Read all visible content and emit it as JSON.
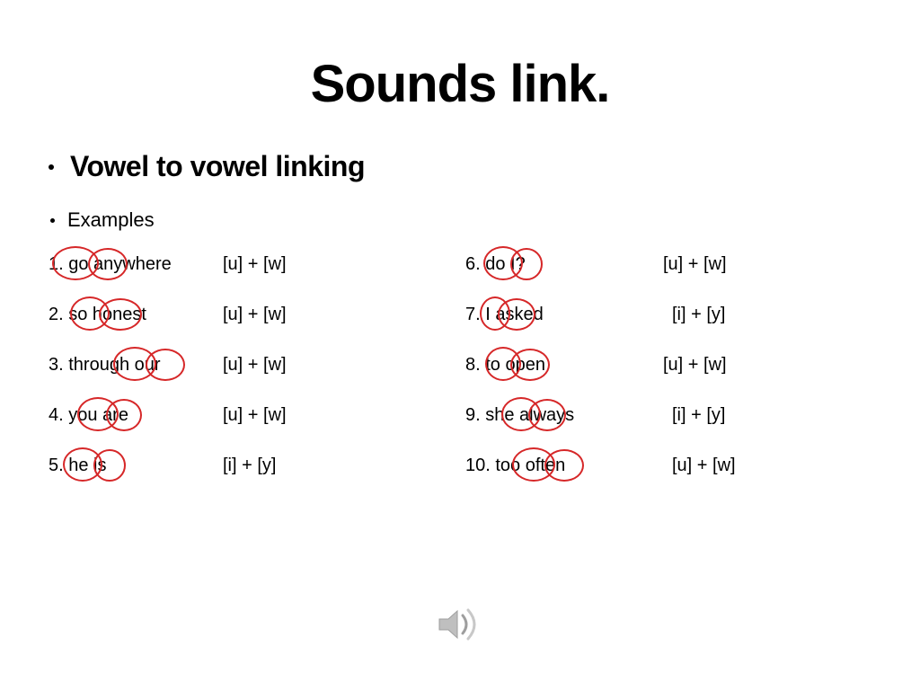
{
  "title": "Sounds link.",
  "subtitle": "Vowel to vowel linking",
  "examples_label": "Examples",
  "rows": {
    "r1": {
      "left_phrase": "1. go anywhere",
      "left_notation": "[u] + [w]",
      "right_phrase": "6. do I?",
      "right_notation": "[u] + [w]"
    },
    "r2": {
      "left_phrase": "2. so honest",
      "left_notation": "[u] + [w]",
      "right_phrase": "7. I asked",
      "right_notation": "[i] + [y]"
    },
    "r3": {
      "left_phrase": "3. through our",
      "left_notation": "[u] + [w]",
      "right_phrase": "8. to open",
      "right_notation": "[u] + [w]"
    },
    "r4": {
      "left_phrase": "4. you are",
      "left_notation": "[u] + [w]",
      "right_phrase": "9. she always",
      "right_notation": "[i] + [y]"
    },
    "r5": {
      "left_phrase": "5. he is",
      "left_notation": "[i] + [y]",
      "right_phrase": "10. too often",
      "right_notation": "[u] + [w]"
    }
  },
  "icons": {
    "speaker": "speaker-icon"
  },
  "colors": {
    "annotation_red": "#d62728",
    "speaker_fill": "#bfbfbf",
    "speaker_wave": "#9e9e9e"
  }
}
